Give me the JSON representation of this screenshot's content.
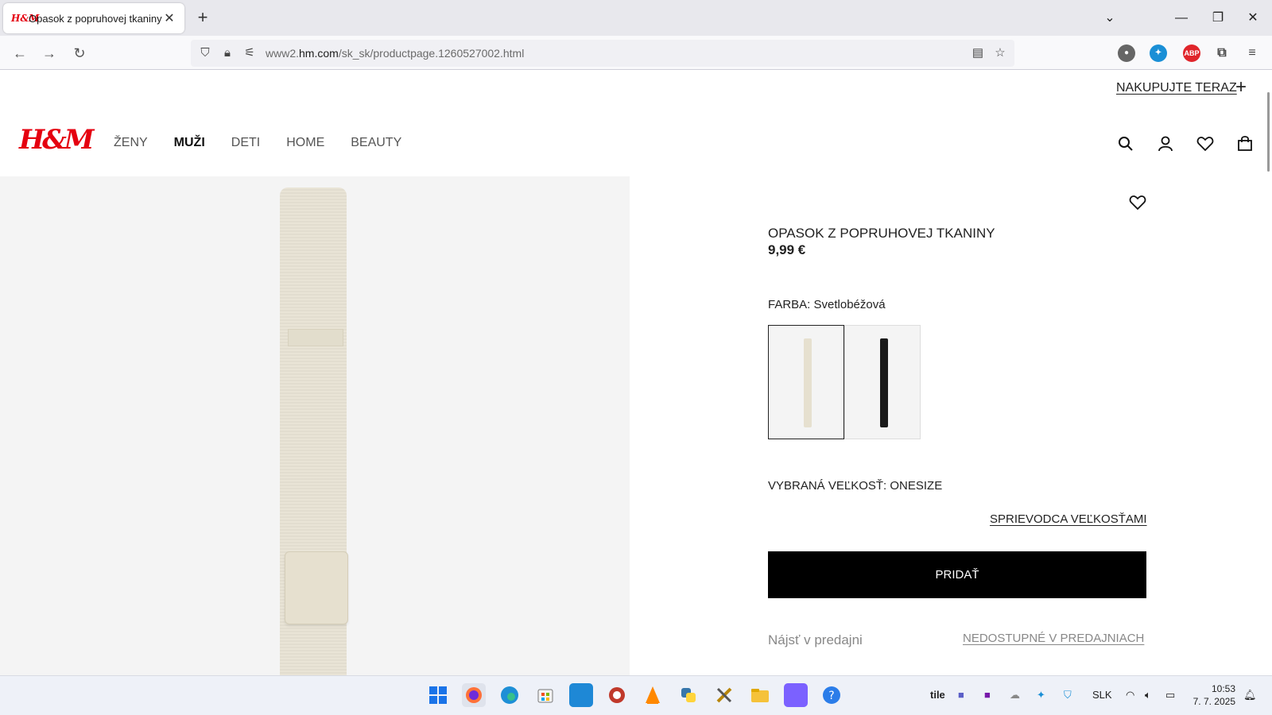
{
  "browser": {
    "tab_title": "Opasok z popruhovej tkaniny -",
    "tab_favicon": "H&M",
    "new_tab": "+",
    "url_prefix": "www2.",
    "url_domain": "hm.com",
    "url_path": "/sk_sk/productpage.1260527002.html",
    "ext_abp": "ABP"
  },
  "header": {
    "shop_now": "NAKUPUJTE TERAZ",
    "logo": "H&M",
    "nav": [
      "ŽENY",
      "MUŽI",
      "DETI",
      "HOME",
      "BEAUTY"
    ],
    "active_nav": "MUŽI"
  },
  "product": {
    "title": "OPASOK Z POPRUHOVEJ TKANINY",
    "price": "9,99 €",
    "color_label": "FARBA: Svetlobéžová",
    "swatches": [
      {
        "name": "Svetlobéžová",
        "color": "#e6e0cf",
        "selected": true
      },
      {
        "name": "Čierna",
        "color": "#1a1a1a",
        "selected": false
      }
    ],
    "size_label": "VYBRANÁ VEĽKOSŤ: ONESIZE",
    "size_guide": "SPRIEVODCA VEĽKOSŤAMI",
    "add_button": "PRIDAŤ",
    "find_store": "Nájsť v predajni",
    "unavailable": "NEDOSTUPNÉ V PREDAJNIACH"
  },
  "taskbar": {
    "tray_items": [
      "tile",
      "SLK"
    ],
    "time": "10:53",
    "date": "7. 7. 2025"
  },
  "colors": {
    "brand_red": "#e50010",
    "button_black": "#000000"
  }
}
